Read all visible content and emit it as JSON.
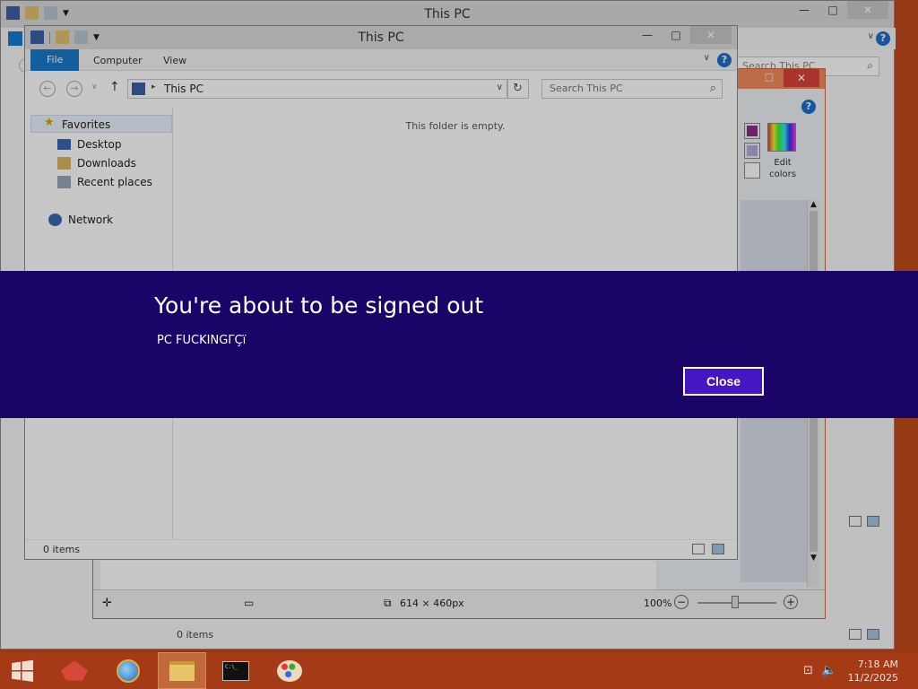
{
  "back_window": {
    "title": "This PC",
    "search_placeholder": "Search This PC",
    "status": "0 items"
  },
  "paint_window": {
    "status": {
      "dimensions": "614 × 460px",
      "zoom": "100%"
    },
    "colors": {
      "swatch_1": "#8c2c88",
      "swatch_2": "#b9a8d8",
      "edit_colors_label_1": "Edit",
      "edit_colors_label_2": "colors"
    }
  },
  "front_window": {
    "title": "This PC",
    "tabs": [
      "File",
      "Computer",
      "View"
    ],
    "address": "This PC",
    "search_placeholder": "Search This PC",
    "empty_message": "This folder is empty.",
    "nav": {
      "favorites": "Favorites",
      "items": [
        "Desktop",
        "Downloads",
        "Recent places"
      ],
      "network": "Network"
    },
    "status": "0 items"
  },
  "signout_banner": {
    "title": "You're about to be signed out",
    "message": "PC FUCKINGΓÇï",
    "close_label": "Close"
  },
  "taskbar": {
    "apps": [
      "start-icon",
      "app-icon",
      "browser-icon",
      "file-explorer-icon",
      "command-prompt-icon",
      "paint-icon"
    ],
    "clock": {
      "time": "7:18 AM",
      "date": "11/2/2025"
    }
  },
  "colors": {
    "banner_bg": "#1b0467",
    "button_bg": "#4416c4",
    "desktop": "#c04a1c",
    "taskbar": "#a53a16"
  }
}
